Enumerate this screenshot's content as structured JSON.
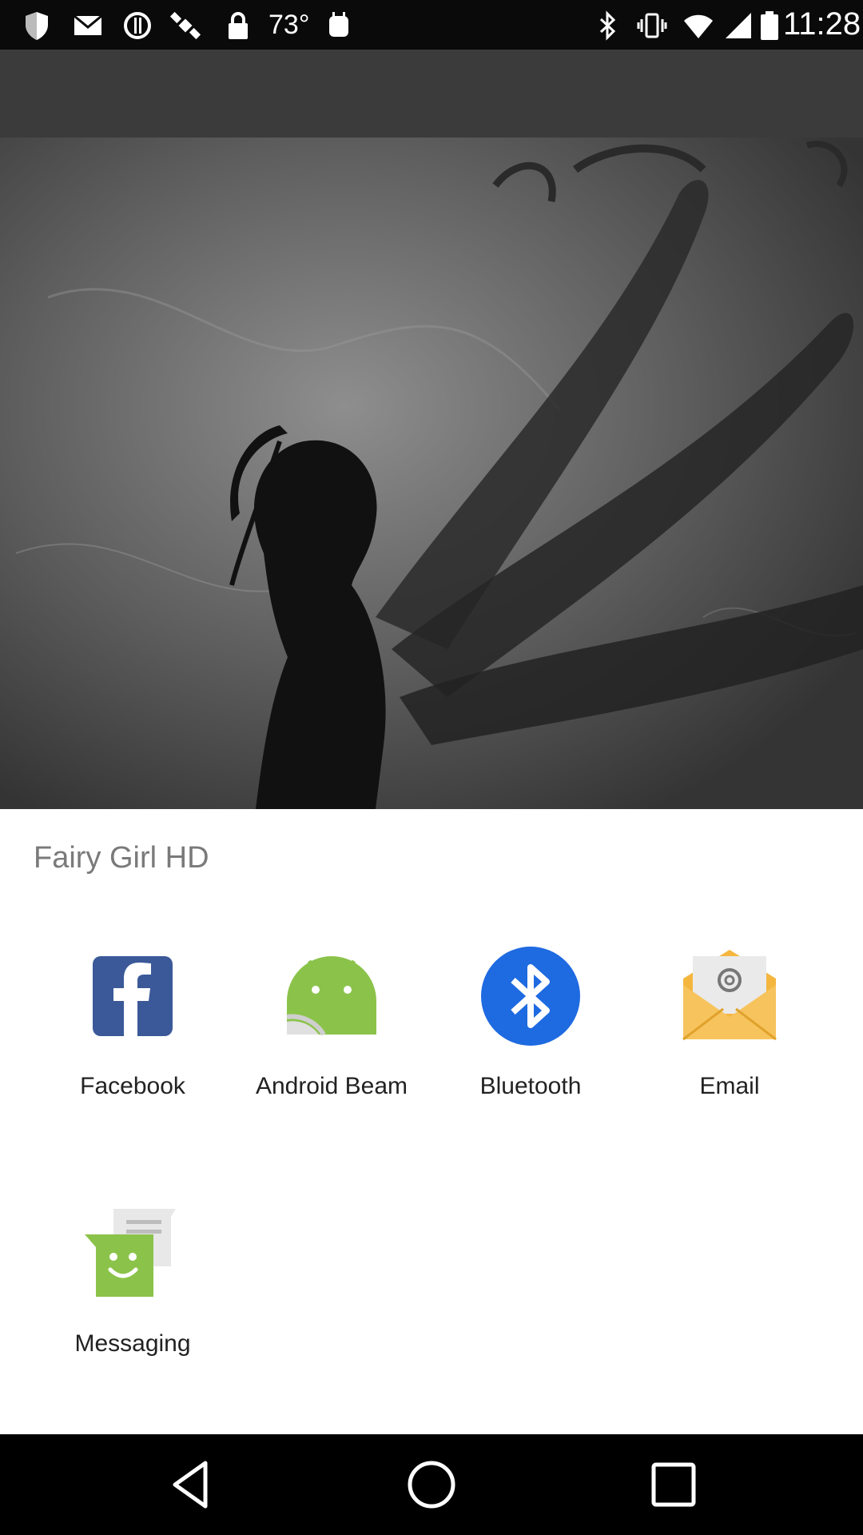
{
  "status_bar": {
    "temperature": "73°",
    "time": "11:28",
    "left_icons": [
      "shield-icon",
      "mail-icon",
      "sync-icon",
      "satellite-icon",
      "lock-icon",
      "temperature-text",
      "android-debug-icon"
    ],
    "right_icons": [
      "bluetooth-icon",
      "vibrate-icon",
      "wifi-icon",
      "signal-icon",
      "battery-icon"
    ]
  },
  "share_sheet": {
    "title": "Fairy Girl HD",
    "targets": [
      {
        "label": "Facebook",
        "icon": "facebook-icon",
        "color": "#3b5998"
      },
      {
        "label": "Android Beam",
        "icon": "android-beam-icon",
        "color": "#8bc34a"
      },
      {
        "label": "Bluetooth",
        "icon": "bluetooth-icon",
        "color": "#1e6ae1"
      },
      {
        "label": "Email",
        "icon": "email-icon",
        "color": "#f4b63f"
      },
      {
        "label": "Messaging",
        "icon": "messaging-icon",
        "color": "#8bc34a"
      }
    ]
  },
  "nav_bar": {
    "buttons": [
      "back-icon",
      "home-icon",
      "recents-icon"
    ]
  }
}
